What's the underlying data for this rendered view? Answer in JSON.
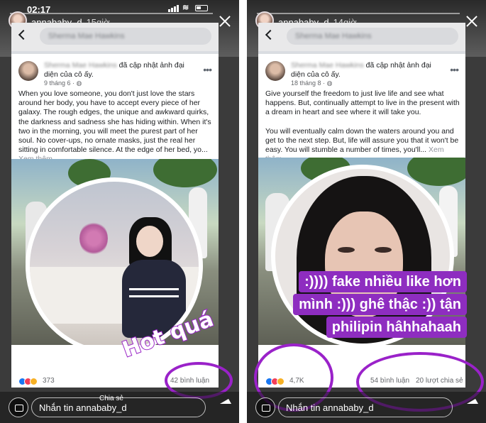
{
  "left_story": {
    "status_time": "02:17",
    "username": "annababy_d",
    "story_time": "15giờ",
    "search_text": "Sherma Mae Hawkins",
    "post_author": "Sherma Mae Hawkins",
    "post_action": "đã cập nhật ảnh đại diện của cô ấy.",
    "post_date": "9 tháng 6 ·",
    "post_text": "When you love someone, you don't just love the stars around her body, you have to accept every piece of her galaxy. The rough edges, the unique and awkward quirks, the darkness and sadness she has hiding within. When it's two in the morning, you will meet the purest part of her soul. No cover-ups, no ornate masks, just the real her sitting in comfortable silence. At the edge of her bed, yo...",
    "see_more": "Xem thêm",
    "reaction_count": "373",
    "comments": "42 bình luận",
    "share_label": "Chia sẻ",
    "sticker_text": "Hot quá",
    "message_placeholder": "Nhắn tin annababy_d"
  },
  "right_story": {
    "username": "annababy_d",
    "story_time": "14giờ",
    "search_text": "Sherma Mae Hawkins",
    "post_author": "Sherma Mae Hawkins",
    "post_action": "đã cập nhật ảnh đại diện của cô ấy.",
    "post_date": "18 tháng 8 ·",
    "post_text_1": "Give yourself the freedom to just live life and see what happens. But, continually attempt to live in the present with a dream in heart and see where it will take you.",
    "post_text_2": "You will eventually calm down the waters around you and get to the next step. But, life will assure you that it won't be easy. You will stumble a number of times, you'll...",
    "see_more": "Xem thêm",
    "reaction_count": "4,7K",
    "comments": "54 bình luận",
    "shares": "20 lượt chia sẻ",
    "caption_lines": [
      ":))))  fake nhiều like hơn",
      "mình :))) ghê thậc :)) tận",
      "philipin hâhhahaah"
    ],
    "message_placeholder": "Nhắn tin annababy_d"
  },
  "colors": {
    "annotation_purple": "#9a22c9",
    "fb_blue": "#1877f2",
    "like_red": "#f33e58",
    "haha_yellow": "#f7b125"
  }
}
